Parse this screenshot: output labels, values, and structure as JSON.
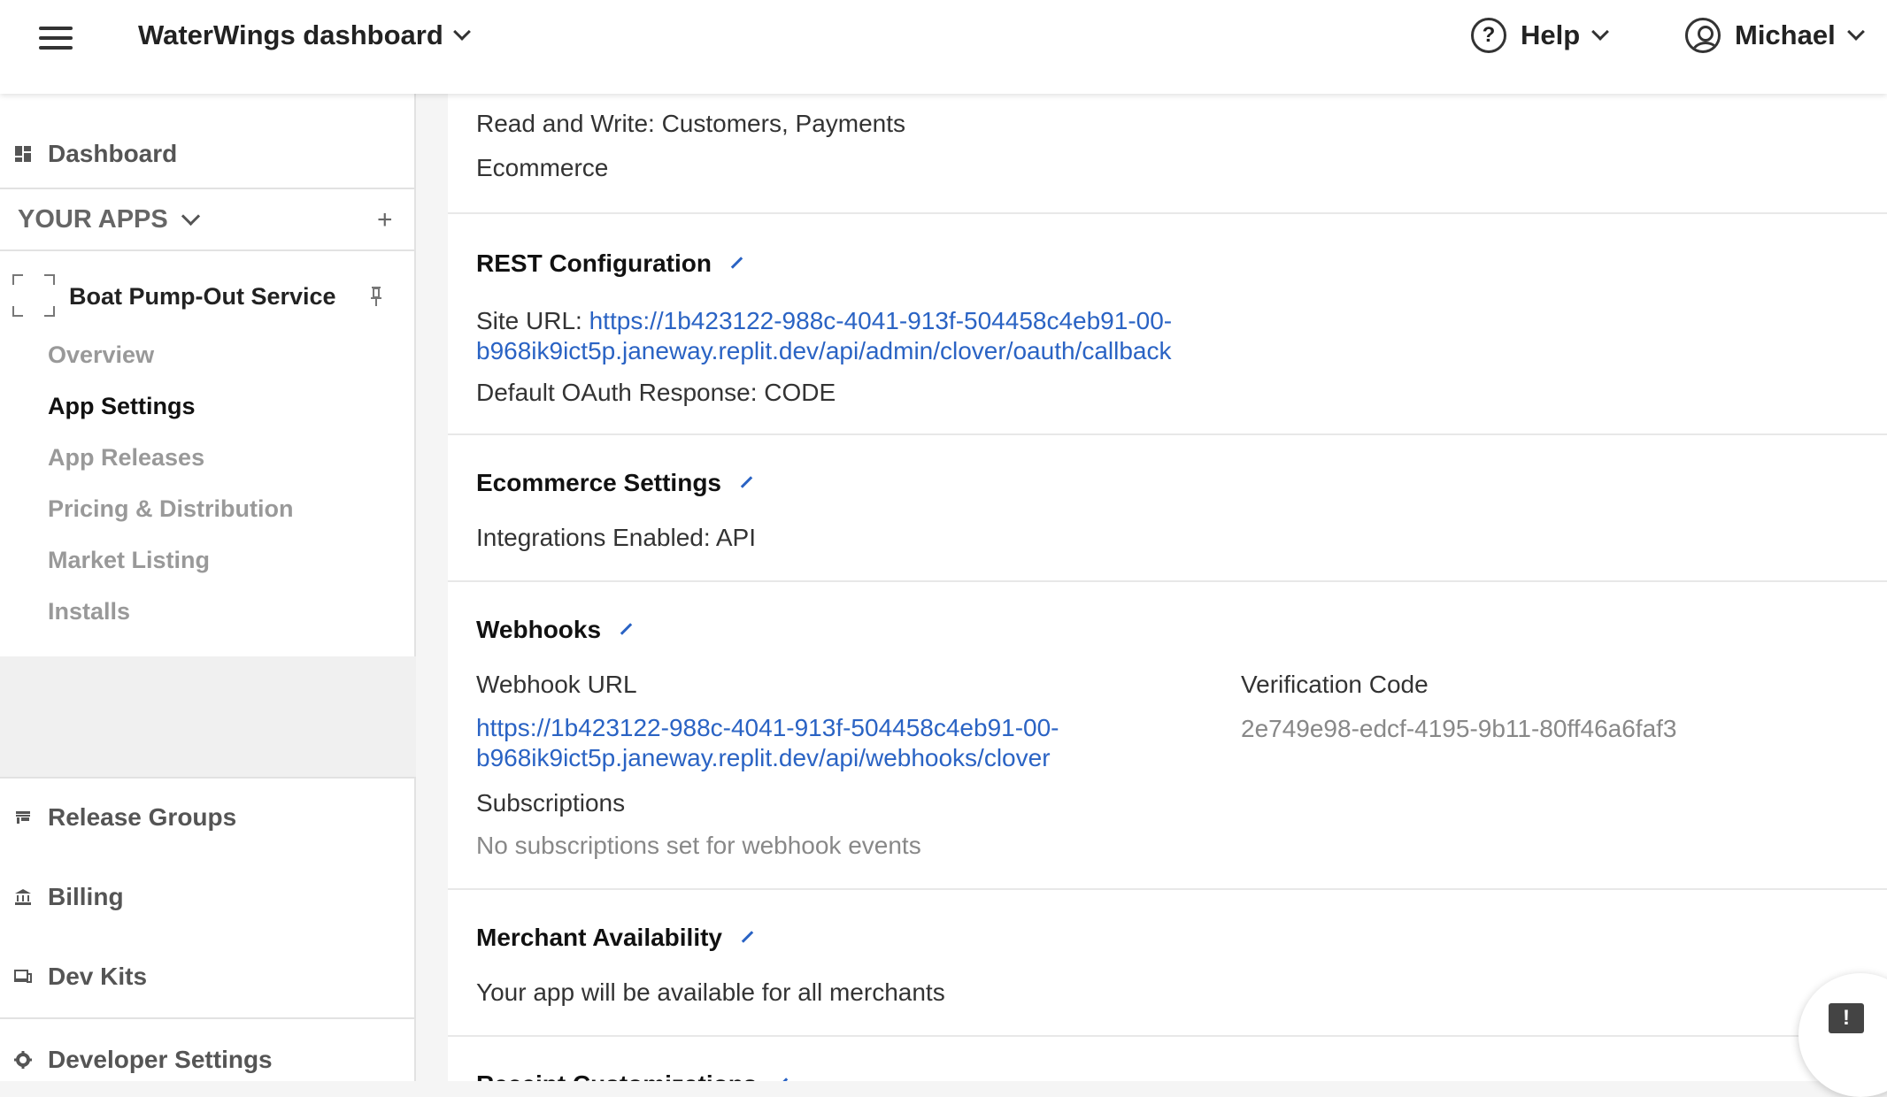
{
  "header": {
    "title": "WaterWings dashboard",
    "help_label": "Help",
    "user_name": "Michael"
  },
  "sidebar": {
    "dashboard_label": "Dashboard",
    "your_apps_label": "YOUR APPS",
    "add_symbol": "+",
    "app_name": "Boat Pump-Out Service",
    "app_nav": [
      {
        "label": "Overview",
        "active": false
      },
      {
        "label": "App Settings",
        "active": true
      },
      {
        "label": "App Releases",
        "active": false
      },
      {
        "label": "Pricing & Distribution",
        "active": false
      },
      {
        "label": "Market Listing",
        "active": false
      },
      {
        "label": "Installs",
        "active": false
      }
    ],
    "bottom_nav": [
      {
        "label": "Release Groups",
        "icon": "store-icon"
      },
      {
        "label": "Billing",
        "icon": "bank-icon"
      },
      {
        "label": "Dev Kits",
        "icon": "devices-icon"
      },
      {
        "label": "Developer Settings",
        "icon": "gear-icon"
      }
    ]
  },
  "main": {
    "permissions_line": "Read and Write: Customers, Payments",
    "category_line": "Ecommerce",
    "rest": {
      "heading": "REST Configuration",
      "site_url_label": "Site URL:",
      "site_url_line1": "https://1b423122-988c-4041-913f-504458c4eb91-00-",
      "site_url_line2": "b968ik9ict5p.janeway.replit.dev/api/admin/clover/oauth/callback",
      "oauth_response": "Default OAuth Response: CODE"
    },
    "ecommerce": {
      "heading": "Ecommerce Settings",
      "integrations": "Integrations Enabled: API"
    },
    "webhooks": {
      "heading": "Webhooks",
      "url_label": "Webhook URL",
      "url_line1": "https://1b423122-988c-4041-913f-504458c4eb91-00-",
      "url_line2": "b968ik9ict5p.janeway.replit.dev/api/webhooks/clover",
      "verification_label": "Verification Code",
      "verification_code": "2e749e98-edcf-4195-9b11-80ff46a6faf3",
      "subscriptions_label": "Subscriptions",
      "subscriptions_value": "No subscriptions set for webhook events"
    },
    "merchant": {
      "heading": "Merchant Availability",
      "text": "Your app will be available for all merchants"
    },
    "receipt": {
      "heading": "Receipt Customizations"
    }
  },
  "colors": {
    "link": "#2a63c4",
    "muted": "#888888"
  }
}
